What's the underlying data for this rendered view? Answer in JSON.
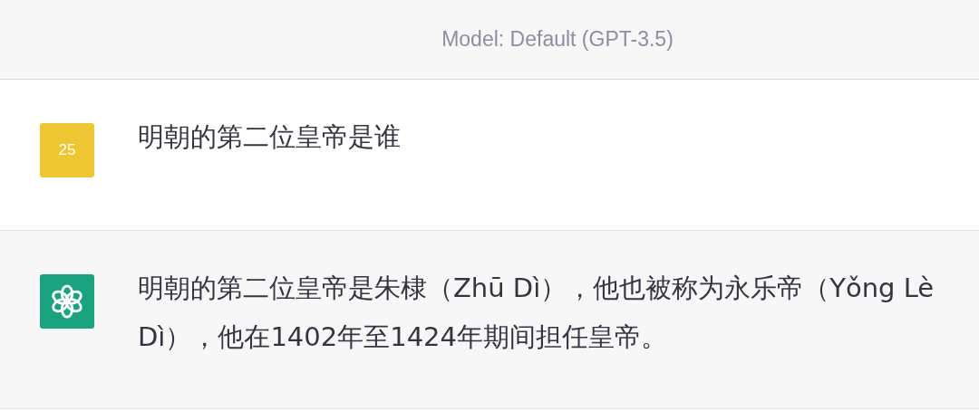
{
  "header": {
    "model_label": "Model: Default (GPT-3.5)"
  },
  "messages": [
    {
      "kind": "user",
      "avatar_text": "25",
      "color": "#eec632",
      "text": "明朝的第二位皇帝是谁"
    },
    {
      "kind": "assistant",
      "color": "#19a37f",
      "text": "明朝的第二位皇帝是朱棣（Zhū Dì），他也被称为永乐帝（Yǒng Lè Dì），他在1402年至1424年期间担任皇帝。"
    }
  ]
}
